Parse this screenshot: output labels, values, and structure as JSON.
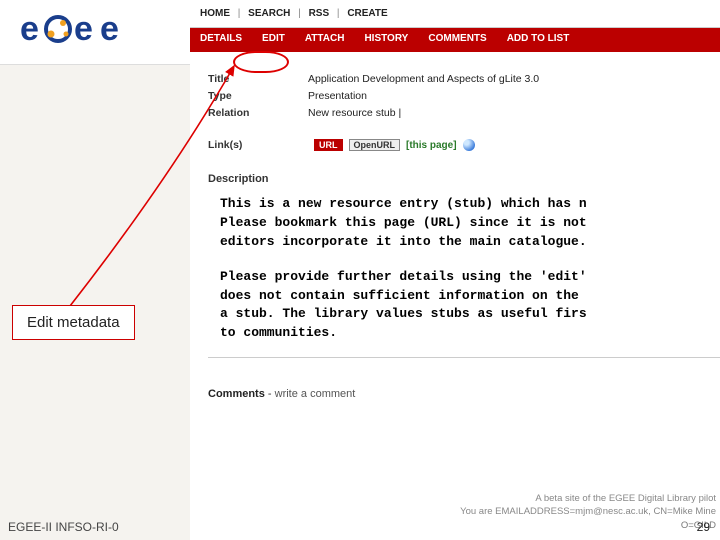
{
  "topnav": {
    "home": "HOME",
    "search": "SEARCH",
    "rss": "RSS",
    "create": "CREATE"
  },
  "tabs": {
    "details": "DETAILS",
    "edit": "EDIT",
    "attach": "ATTACH",
    "history": "HISTORY",
    "comments": "COMMENTS",
    "addtolist": "ADD TO LIST"
  },
  "meta": {
    "title_label": "Title",
    "type_label": "Type",
    "relation_label": "Relation",
    "links_label": "Link(s)",
    "title_val": "Application Development and Aspects of gLite 3.0",
    "type_val": "Presentation",
    "relation_val": "New resource stub |"
  },
  "links": {
    "url_badge": "URL",
    "openurl": "OpenURL",
    "thispage": "[this page]"
  },
  "description": {
    "heading": "Description",
    "para1": "This is a new resource entry (stub) which has n\nPlease bookmark this page (URL) since it is not\neditors incorporate it into the main catalogue.",
    "para2": "Please provide further details using the 'edit'\ndoes not contain sufficient information on the \na stub. The library values stubs as useful firs\nto communities."
  },
  "comments": {
    "label": "Comments",
    "dash": " - ",
    "link": "write a comment"
  },
  "beta": {
    "line1": "A beta site of the EGEE Digital Library pilot",
    "line2": "You are EMAILADDRESS=mjm@nesc.ac.uk, CN=Mike Mine",
    "line3": "O=GILD"
  },
  "callout": "Edit metadata",
  "footer_left": "EGEE-II INFSO-RI-0",
  "pagenum": "29"
}
